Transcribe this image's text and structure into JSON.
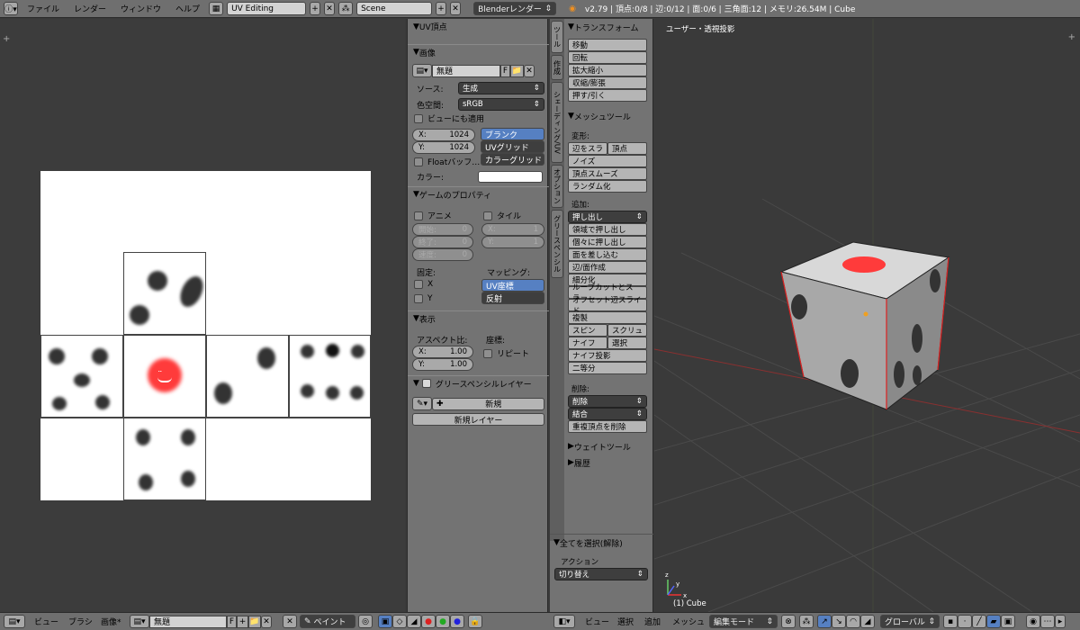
{
  "topbar": {
    "menus": [
      "ファイル",
      "レンダー",
      "ウィンドウ",
      "ヘルプ"
    ],
    "screen_layout": "UV Editing",
    "scene": "Scene",
    "render_engine": "Blenderレンダー",
    "stats": "v2.79 | 頂点:0/8 | 辺:0/12 | 面:0/6 | 三角面:12 | メモリ:26.54M | Cube"
  },
  "image_panel": {
    "uv_vertex_header": "UV頂点",
    "image_header": "画像",
    "image_name": "無題",
    "fake_user": "F",
    "source_label": "ソース:",
    "source_value": "生成",
    "colorspace_label": "色空間:",
    "colorspace_value": "sRGB",
    "view_as_render": "ビューにも適用",
    "x_label": "X:",
    "x_value": "1024",
    "y_label": "Y:",
    "y_value": "1024",
    "types": [
      "ブランク",
      "UVグリッド",
      "カラーグリッド"
    ],
    "float_buffer": "Floatバッフ…",
    "color_label": "カラー:"
  },
  "game_props": {
    "header": "ゲームのプロパティ",
    "anim": "アニメ",
    "tiles": "タイル",
    "start": "開始:",
    "start_val": "0",
    "end": "終了:",
    "end_val": "0",
    "speed": "速度:",
    "speed_val": "0",
    "tx": "X:",
    "tx_val": "1",
    "ty": "Y:",
    "ty_val": "1",
    "clamp": "固定:",
    "clamp_x": "X",
    "clamp_y": "Y",
    "mapping": "マッピング:",
    "uv_coords": "UV座標",
    "reflection": "反射"
  },
  "display": {
    "header": "表示",
    "aspect": "アスペクト比:",
    "coords": "座標:",
    "ax": "X:",
    "ax_val": "1.00",
    "ay": "Y:",
    "ay_val": "1.00",
    "repeat": "リピート"
  },
  "grease": {
    "header": "グリースペンシルレイヤー",
    "new": "新規",
    "new_layer": "新規レイヤー"
  },
  "tool_tabs": [
    "ツール",
    "作成",
    "シェーディング/UV",
    "オプション",
    "グリースペンシル"
  ],
  "tools": {
    "transform_header": "トランスフォーム",
    "transform": [
      "移動",
      "回転",
      "拡大縮小",
      "収縮/膨張",
      "押す/引く"
    ],
    "mesh_header": "メッシュツール",
    "deform_label": "変形:",
    "slide_edge": "辺をスラ",
    "slide_vertex": "頂点",
    "deform": [
      "ノイズ",
      "頂点スムーズ",
      "ランダム化"
    ],
    "add_label": "追加:",
    "extrude": "押し出し",
    "add": [
      "領域で押し出し",
      "個々に押し出し",
      "面を差し込む",
      "辺/面作成",
      "細分化",
      "ループカットとスラ…",
      "オフセット辺スライド",
      "複製"
    ],
    "spin": "スピン",
    "screw": "スクリュ",
    "knife": "ナイフ",
    "select": "選択",
    "knife_project": "ナイフ投影",
    "bisect": "二等分",
    "delete_label": "削除:",
    "delete": "削除",
    "merge": "結合",
    "remove_doubles": "重複頂点を削除",
    "weight_header": "ウェイトツール",
    "history_header": "履歴",
    "op_header": "全てを選択(解除)",
    "action_label": "アクション",
    "action_value": "切り替え"
  },
  "viewport": {
    "view_label": "ユーザー・透視投影",
    "object_label": "(1) Cube"
  },
  "bottombar": {
    "uv_menus": [
      "ビュー",
      "ブラシ",
      "画像*"
    ],
    "image_name": "無題",
    "fake_user": "F",
    "mode": "ペイント",
    "view3d_menus": [
      "ビュー",
      "選択",
      "追加",
      "メッシュ"
    ],
    "edit_mode": "編集モード",
    "orientation": "グローバル"
  },
  "colors": {
    "selected": "#5680c2",
    "panel": "#737373",
    "header": "#6f6f6f",
    "viewport": "#3a3a3a"
  }
}
